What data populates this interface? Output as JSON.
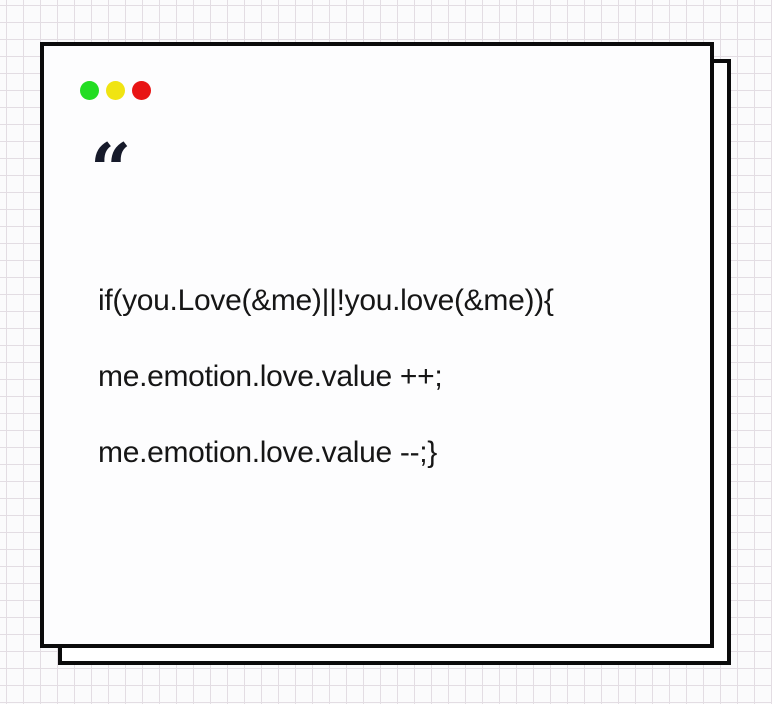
{
  "window": {
    "controls": [
      {
        "name": "green-dot",
        "color": "#22dd22"
      },
      {
        "name": "yellow-dot",
        "color": "#f0e412"
      },
      {
        "name": "red-dot",
        "color": "#e81414"
      }
    ]
  },
  "quote": {
    "mark": "“"
  },
  "code": {
    "lines": [
      "if(you.Love(&me)||!you.love(&me)){",
      "me.emotion.love.value ++;",
      "me.emotion.love.value --;}"
    ]
  }
}
